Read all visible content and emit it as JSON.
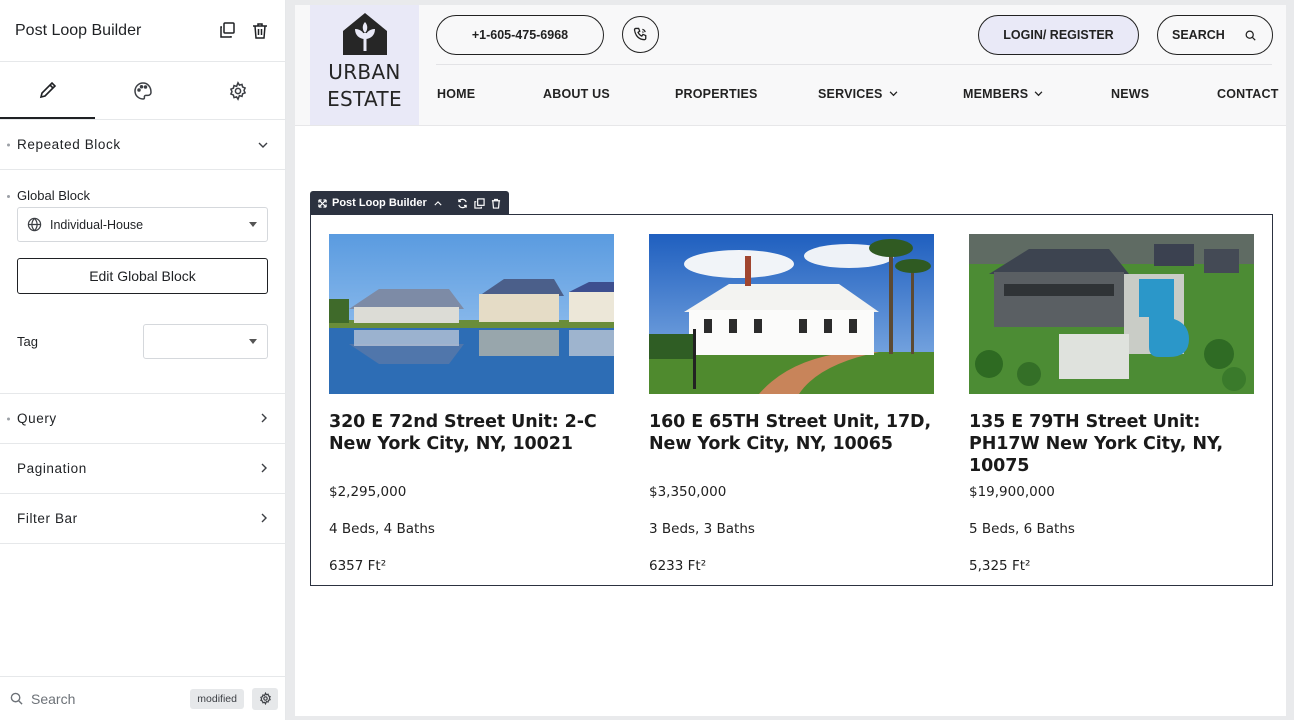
{
  "panel": {
    "title": "Post Loop Builder",
    "header_icons": [
      "copy-icon",
      "trash-icon"
    ],
    "tabs": [
      {
        "icon": "pencil-icon",
        "active": true
      },
      {
        "icon": "palette-icon",
        "active": false
      },
      {
        "icon": "gear-icon",
        "active": false
      }
    ],
    "sections": {
      "repeated_block": "Repeated Block",
      "query": "Query",
      "pagination": "Pagination",
      "filter_bar": "Filter Bar"
    },
    "global_block": {
      "label": "Global Block",
      "value": "Individual-House",
      "edit_button": "Edit Global Block"
    },
    "tag": {
      "label": "Tag",
      "value": ""
    },
    "footer": {
      "search_placeholder": "Search",
      "badge": "modified"
    }
  },
  "site": {
    "logo_line1": "URBAN",
    "logo_line2": "ESTATE",
    "phone": "+1-605-475-6968",
    "login": "LOGIN/ REGISTER",
    "search": "SEARCH",
    "nav": [
      {
        "label": "HOME"
      },
      {
        "label": "ABOUT US"
      },
      {
        "label": "PROPERTIES"
      },
      {
        "label": "SERVICES"
      },
      {
        "label": "MEMBERS"
      },
      {
        "label": "NEWS"
      },
      {
        "label": "CONTACT"
      }
    ],
    "accent_color": "#e9e9f7"
  },
  "widget": {
    "label": "Post Loop Builder"
  },
  "properties": [
    {
      "title": "320 E 72nd Street Unit: 2-C New York City, NY, 10021",
      "price": "$2,295,000",
      "beds": "4 Beds, 4 Baths",
      "area": "6357 Ft²"
    },
    {
      "title": "160 E 65TH Street Unit, 17D, New York City, NY, 10065",
      "price": "$3,350,000",
      "beds": "3 Beds, 3 Baths",
      "area": "6233 Ft²"
    },
    {
      "title": "135 E 79TH Street Unit: PH17W New York City, NY, 10075",
      "price": "$19,900,000",
      "beds": "5 Beds, 6 Baths",
      "area": "5,325 Ft²"
    }
  ]
}
